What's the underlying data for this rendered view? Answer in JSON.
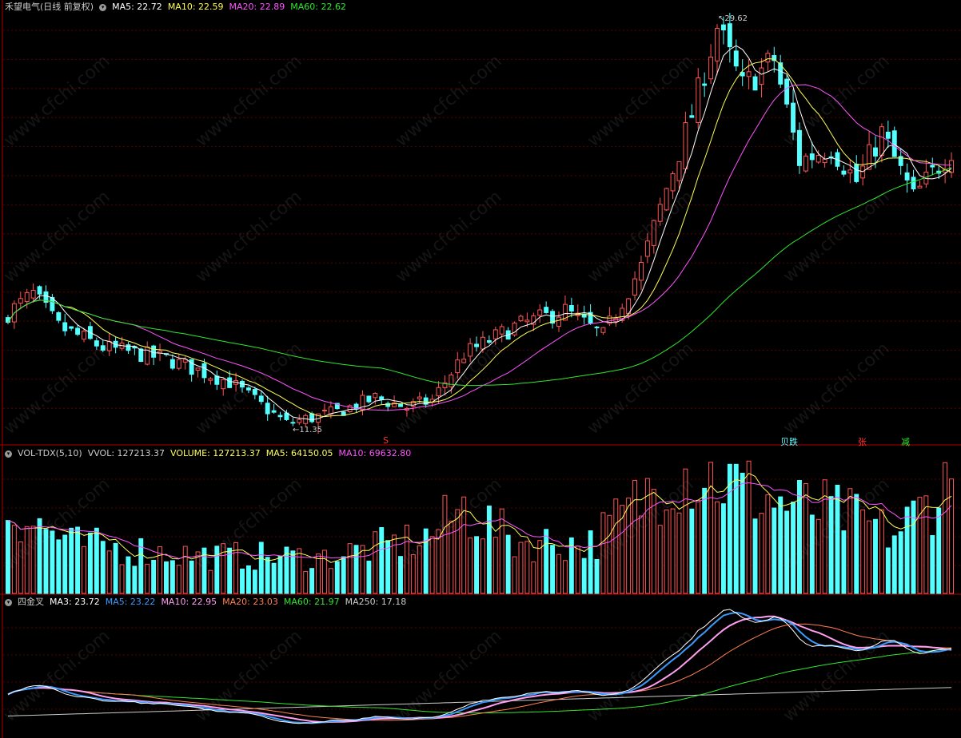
{
  "colors": {
    "up": "#ff5555",
    "down": "#54ffff",
    "ma5": "#ffffff",
    "ma10": "#ffff54",
    "ma20": "#ff54ff",
    "ma60": "#2ee82e",
    "vol_ma5": "#ffff54",
    "vol_ma10": "#ff54ff",
    "i_ma3": "#ffffff",
    "i_ma5": "#3a9bff",
    "i_ma10": "#ff9ff0",
    "i_ma20": "#ff7f50",
    "i_ma60": "#2ee82e",
    "i_ma250": "#cccccc",
    "grid": "#5a0000",
    "border": "#b00000"
  },
  "price_panel": {
    "title": "禾望电气(日线 前复权)",
    "ma_labels": [
      {
        "text": "MA5: 22.72",
        "color": "#ffffff"
      },
      {
        "text": "MA10: 22.59",
        "color": "#ffff54"
      },
      {
        "text": "MA20: 22.89",
        "color": "#ff54ff"
      },
      {
        "text": "MA60: 22.62",
        "color": "#2ee82e"
      }
    ],
    "high_label": "29.62",
    "low_label": "11.35",
    "signals": [
      {
        "text": "S",
        "color": "#ff3030"
      },
      {
        "text": "跌",
        "color": "#54ffff"
      },
      {
        "text": "张",
        "color": "#ff3030"
      },
      {
        "text": "减",
        "color": "#2ee82e"
      }
    ]
  },
  "volume_panel": {
    "title": "VOL-TDX(5,10)",
    "labels": [
      {
        "text": "VVOL: 127213.37",
        "color": "#cccccc"
      },
      {
        "text": "VOLUME: 127213.37",
        "color": "#ffff54"
      },
      {
        "text": "MA5: 64150.05",
        "color": "#ffff54"
      },
      {
        "text": "MA10: 69632.80",
        "color": "#ff54ff"
      }
    ]
  },
  "indicator_panel": {
    "title": "四金叉",
    "labels": [
      {
        "text": "MA3: 23.72",
        "color": "#ffffff"
      },
      {
        "text": "MA5: 23.22",
        "color": "#3a9bff"
      },
      {
        "text": "MA10: 22.95",
        "color": "#ff9ff0"
      },
      {
        "text": "MA20: 23.03",
        "color": "#ff7f50"
      },
      {
        "text": "MA60: 21.97",
        "color": "#2ee82e"
      },
      {
        "text": "MA250: 17.18",
        "color": "#cccccc"
      }
    ]
  },
  "watermark": "www.cfchi.com",
  "chart_data": {
    "type": "candlestick",
    "title": "禾望电气(日线 前复权)",
    "bars": 150,
    "price_range": [
      11.35,
      29.62
    ],
    "keyframes": [
      {
        "t": 0,
        "close": 16.6
      },
      {
        "t": 4,
        "close": 17.4
      },
      {
        "t": 8,
        "close": 16.0
      },
      {
        "t": 15,
        "close": 15.1
      },
      {
        "t": 25,
        "close": 14.6
      },
      {
        "t": 35,
        "close": 13.6
      },
      {
        "t": 44,
        "close": 11.8
      },
      {
        "t": 52,
        "close": 12.3
      },
      {
        "t": 58,
        "close": 12.9
      },
      {
        "t": 63,
        "close": 12.5
      },
      {
        "t": 67,
        "close": 12.8
      },
      {
        "t": 72,
        "close": 14.8
      },
      {
        "t": 80,
        "close": 16.0
      },
      {
        "t": 88,
        "close": 16.7
      },
      {
        "t": 94,
        "close": 15.6
      },
      {
        "t": 100,
        "close": 18.6
      },
      {
        "t": 104,
        "close": 22.0
      },
      {
        "t": 108,
        "close": 25.2
      },
      {
        "t": 112,
        "close": 29.0
      },
      {
        "t": 116,
        "close": 26.4
      },
      {
        "t": 121,
        "close": 27.6
      },
      {
        "t": 125,
        "close": 23.2
      },
      {
        "t": 130,
        "close": 23.8
      },
      {
        "t": 134,
        "close": 22.3
      },
      {
        "t": 138,
        "close": 24.4
      },
      {
        "t": 143,
        "close": 21.6
      },
      {
        "t": 149,
        "close": 23.7
      }
    ],
    "volume_keyframes": [
      {
        "t": 0,
        "v": 95000
      },
      {
        "t": 10,
        "v": 55000
      },
      {
        "t": 30,
        "v": 42000
      },
      {
        "t": 50,
        "v": 40000
      },
      {
        "t": 66,
        "v": 62000
      },
      {
        "t": 72,
        "v": 95000
      },
      {
        "t": 80,
        "v": 58000
      },
      {
        "t": 92,
        "v": 55000
      },
      {
        "t": 100,
        "v": 105000
      },
      {
        "t": 105,
        "v": 140000
      },
      {
        "t": 112,
        "v": 128000
      },
      {
        "t": 122,
        "v": 100000
      },
      {
        "t": 132,
        "v": 88000
      },
      {
        "t": 140,
        "v": 65000
      },
      {
        "t": 149,
        "v": 127213
      }
    ],
    "ma": {
      "ma5": 22.72,
      "ma10": 22.59,
      "ma20": 22.89,
      "ma60": 22.62
    },
    "volume": {
      "vvol": 127213.37,
      "ma5": 64150.05,
      "ma10": 69632.8
    },
    "indicator": {
      "ma3": 23.72,
      "ma5": 23.22,
      "ma10": 22.95,
      "ma20": 23.03,
      "ma60": 21.97,
      "ma250": 17.18
    }
  }
}
